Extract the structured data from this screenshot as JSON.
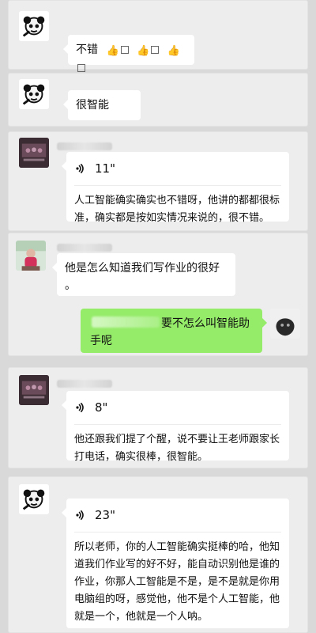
{
  "messages": {
    "p1": {
      "text": "不错",
      "emoji": {
        "glyph": "👍"
      }
    },
    "p2": {
      "text": "很智能"
    },
    "p3": {
      "voice": {
        "duration": "11\""
      },
      "transcript": "人工智能确实确实也不错呀，他讲的都都很标\n准，确实都是按如实情况来说的，很不错。"
    },
    "p4": {
      "left_line1": "他是怎么知道我们写作业的很好",
      "left_line2": "。",
      "right_line1": "要不怎么叫智能助",
      "right_line2": "手呢"
    },
    "p5": {
      "voice": {
        "duration": "8\""
      },
      "transcript": "他还跟我们提了个醒，说不要让王老师跟家长\n打电话，确实很棒，很智能。"
    },
    "p6": {
      "voice": {
        "duration": "23\""
      },
      "transcript": "所以老师，你的人工智能确实挺棒的哈，他知\n道我们作业写的好不好，能自动识别他是谁的\n作业，你那人工智能是不是，是不是就是你用\n电脑组的呀，感觉他，他不是个人工智能，他\n就是一个，他就是一个人呐。"
    }
  },
  "colors": {
    "panel_bg": "#ededed",
    "bubble": "#ffffff",
    "my_bubble": "#95ec69",
    "page_bg": "#d9d9d9"
  },
  "icons": {
    "panda": "panda-meme-icon",
    "voice": "voice-wave-icon",
    "thumbs": "thumbs-up-icon",
    "missing": "missing-glyph-box"
  }
}
